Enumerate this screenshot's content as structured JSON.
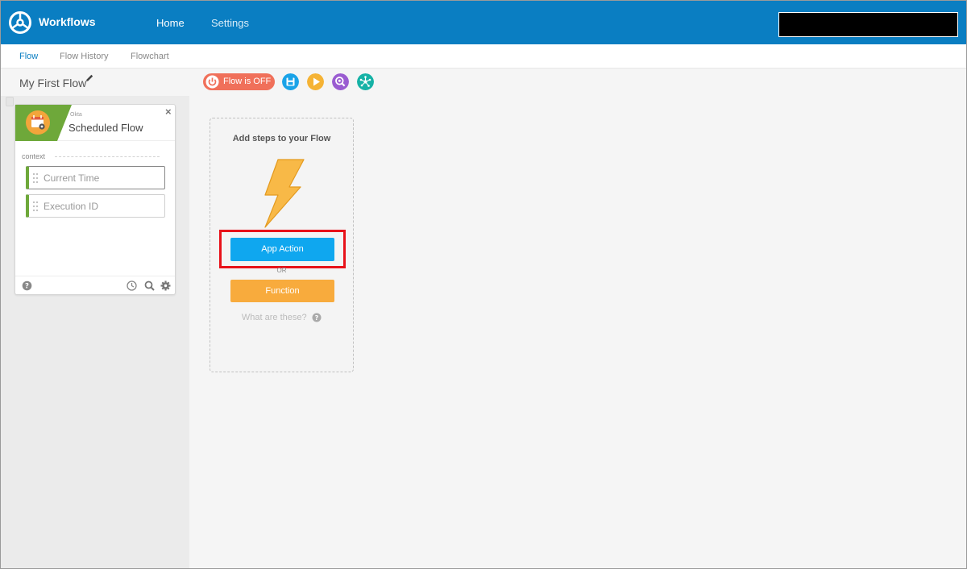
{
  "header": {
    "app_title": "Workflows",
    "nav": {
      "home": "Home",
      "settings": "Settings"
    },
    "brand_color": "#0a7ec2"
  },
  "tabs": [
    {
      "label": "Flow",
      "active": true
    },
    {
      "label": "Flow History",
      "active": false
    },
    {
      "label": "Flowchart",
      "active": false
    }
  ],
  "flow": {
    "name": "My First Flow",
    "status_label": "Flow is OFF",
    "status_color": "#f0705a"
  },
  "toolbar_icons": [
    "save-icon",
    "play-icon",
    "test-zoom-icon",
    "connections-icon"
  ],
  "event_card": {
    "app": "Okta",
    "title": "Scheduled Flow",
    "section": "context",
    "fields": [
      "Current Time",
      "Execution ID"
    ],
    "accent_color": "#6ea83a"
  },
  "canvas": {
    "prompt": "Add steps to your Flow",
    "app_action_label": "App Action",
    "or_label": "OR",
    "function_label": "Function",
    "help_text": "What are these?"
  }
}
